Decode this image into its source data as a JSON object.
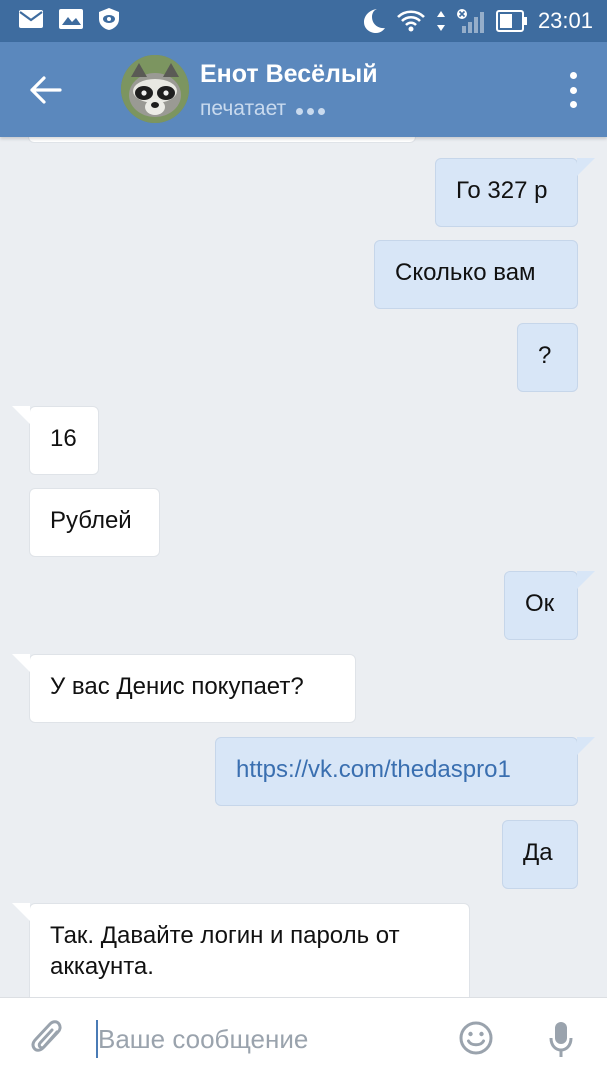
{
  "status_bar": {
    "time": "23:01",
    "left_icons": [
      "mail-icon",
      "gallery-icon",
      "vk-shield-icon"
    ],
    "right_icons": [
      "moon-icon",
      "wifi-icon",
      "data-arrows-icon",
      "signal-icon",
      "battery-icon"
    ]
  },
  "header": {
    "name": "Енот Весёлый",
    "status": "печатает"
  },
  "messages": [
    {
      "dir": "out",
      "text": "Го 327 р"
    },
    {
      "dir": "out",
      "text": "Сколько вам"
    },
    {
      "dir": "out",
      "text": "?"
    },
    {
      "dir": "in",
      "text": "16"
    },
    {
      "dir": "in",
      "text": "Рублей"
    },
    {
      "dir": "out",
      "text": "Ок"
    },
    {
      "dir": "in",
      "text": "У вас Денис покупает?"
    },
    {
      "dir": "out",
      "text": "https://vk.com/thedaspro1",
      "link": true
    },
    {
      "dir": "out",
      "text": "Да"
    },
    {
      "dir": "in",
      "text": "Так. Давайте логин и пароль от аккаунта."
    }
  ],
  "composer": {
    "placeholder": "Ваше сообщение"
  },
  "colors": {
    "status_bar": "#3e6c9f",
    "header": "#5b88bd",
    "background": "#ebeef2",
    "outgoing_bubble": "#d8e6f7",
    "incoming_bubble": "#ffffff",
    "link": "#3a6fb0"
  }
}
